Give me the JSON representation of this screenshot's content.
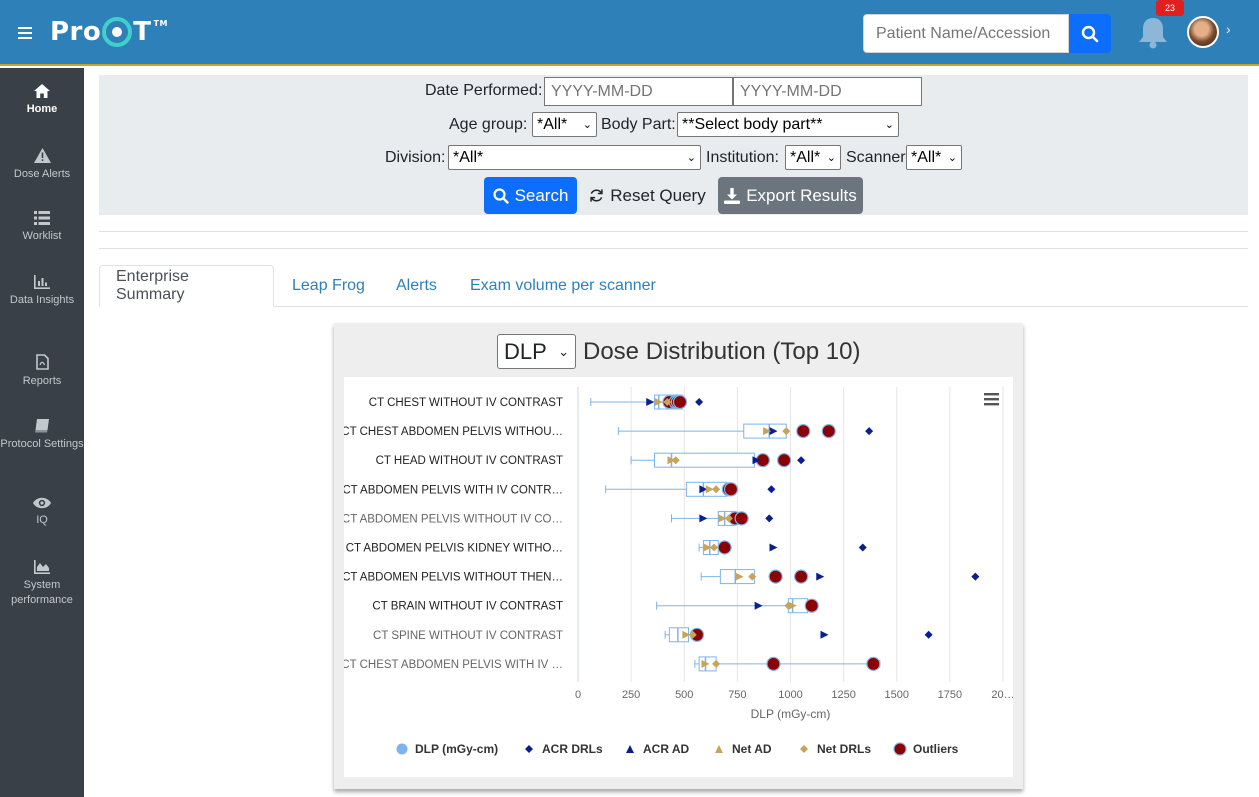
{
  "header": {
    "logo_text_pre": "Pro",
    "logo_text_post": "T",
    "logo_tm": "TM",
    "search_placeholder": "Patient Name/Accession Number",
    "notification_count": "23"
  },
  "sidebar": {
    "items": [
      {
        "label": "Home",
        "icon": "home-icon"
      },
      {
        "label": "Dose Alerts",
        "icon": "warning-icon"
      },
      {
        "label": "Worklist",
        "icon": "list-icon"
      },
      {
        "label": "Data Insights",
        "icon": "bar-chart-icon"
      },
      {
        "label": "Reports",
        "icon": "pdf-file-icon"
      },
      {
        "label": "Protocol Settings",
        "icon": "book-icon"
      },
      {
        "label": "IQ",
        "icon": "eye-icon"
      },
      {
        "label": "System performance",
        "icon": "area-chart-icon"
      }
    ]
  },
  "filters": {
    "date_label": "Date Performed:",
    "date_from_placeholder": "YYYY-MM-DD",
    "date_to_placeholder": "YYYY-MM-DD",
    "age_label": "Age group:",
    "age_value": "*All*",
    "body_label": "Body Part:",
    "body_value": "**Select body part**",
    "division_label": "Division:",
    "division_value": "*All*",
    "institution_label": "Institution:",
    "institution_value": "*All*",
    "scanner_label": "Scanner",
    "scanner_value": "*All*",
    "search_button": "Search",
    "reset_button": "Reset Query",
    "export_button": "Export Results"
  },
  "tabs": [
    "Enterprise Summary",
    "Leap Frog",
    "Alerts",
    "Exam volume per scanner"
  ],
  "chart_header": {
    "metric_value": "DLP",
    "title": "Dose Distribution (Top 10)"
  },
  "chart_data": {
    "type": "boxplot",
    "orientation": "horizontal",
    "xlabel": "DLP (mGy-cm)",
    "xlim": [
      0,
      2000
    ],
    "ticks": [
      0,
      250,
      500,
      750,
      1000,
      1250,
      1500,
      1750,
      2000
    ],
    "tick_labels": [
      "0",
      "250",
      "500",
      "750",
      "1000",
      "1250",
      "1500",
      "1750",
      "20…"
    ],
    "grid": "vertical",
    "legend_position": "bottom",
    "legend": [
      "DLP (mGy-cm)",
      "ACR DRLs",
      "ACR AD",
      "Net AD",
      "Net DRLs",
      "Outliers"
    ],
    "colors": {
      "box": "#7cb5ec",
      "acr_drl": "#0a1f8f",
      "acr_ad": "#0a1f8f",
      "net": "#c8a35a",
      "outlier_fill": "#8b0000",
      "outlier_border": "#7cb5ec"
    },
    "categories": [
      "CT CHEST WITHOUT IV CONTRAST",
      "CT CHEST ABDOMEN PELVIS WITHOU…",
      "CT HEAD WITHOUT IV CONTRAST",
      "CT ABDOMEN PELVIS WITH IV CONTR…",
      "CT ABDOMEN PELVIS WITHOUT IV CO…",
      "CT ABDOMEN PELVIS KIDNEY WITHO…",
      "CT ABDOMEN PELVIS WITHOUT THEN…",
      "CT BRAIN WITHOUT IV CONTRAST",
      "CT SPINE WITHOUT IV CONTRAST",
      "CT CHEST ABDOMEN PELVIS WITH IV …"
    ],
    "boxes": [
      {
        "low": 60,
        "q1": 360,
        "median": 380,
        "q3": 490,
        "high": 490
      },
      {
        "low": 190,
        "q1": 780,
        "median": 900,
        "q3": 980,
        "high": 980
      },
      {
        "low": 250,
        "q1": 360,
        "median": 440,
        "q3": 830,
        "high": 830
      },
      {
        "low": 130,
        "q1": 510,
        "median": 590,
        "q3": 700,
        "high": 700
      },
      {
        "low": 440,
        "q1": 660,
        "median": 690,
        "q3": 740,
        "high": 740
      },
      {
        "low": 570,
        "q1": 590,
        "median": 620,
        "q3": 660,
        "high": 660
      },
      {
        "low": 580,
        "q1": 670,
        "median": 740,
        "q3": 830,
        "high": 830
      },
      {
        "low": 370,
        "q1": 990,
        "median": 1010,
        "q3": 1080,
        "high": 1080
      },
      {
        "low": 410,
        "q1": 430,
        "median": 470,
        "q3": 520,
        "high": 520
      },
      {
        "low": 550,
        "q1": 570,
        "median": 600,
        "q3": 650,
        "high": 1420
      }
    ],
    "acr_drl": [
      570,
      1370,
      1050,
      910,
      900,
      1340,
      1870,
      null,
      1650,
      null
    ],
    "acr_ad": [
      340,
      920,
      840,
      590,
      590,
      920,
      1140,
      850,
      1160,
      null
    ],
    "net_ad": [
      380,
      890,
      440,
      620,
      680,
      610,
      760,
      1010,
      510,
      600
    ],
    "net_drl": [
      420,
      980,
      460,
      650,
      710,
      640,
      820,
      990,
      540,
      650
    ],
    "outliers": [
      [
        430,
        460,
        470,
        480
      ],
      [
        1060,
        1180
      ],
      [
        870,
        970
      ],
      [
        710,
        720
      ],
      [
        740,
        770
      ],
      [
        690
      ],
      [
        930,
        1050
      ],
      [
        1100
      ],
      [
        560
      ],
      [
        920,
        1390
      ]
    ]
  }
}
